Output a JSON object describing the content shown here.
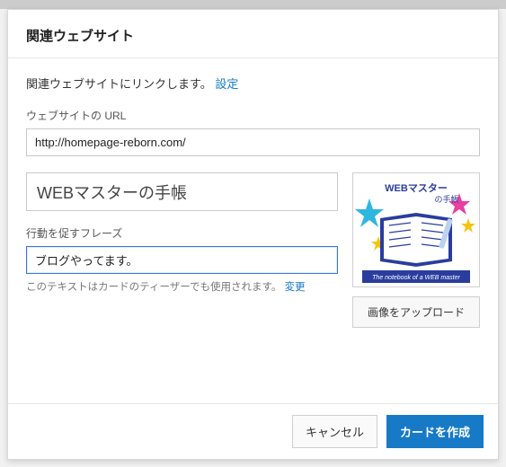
{
  "dialog": {
    "title": "関連ウェブサイト",
    "intro": "関連ウェブサイトにリンクします。",
    "settings_link": "設定"
  },
  "url_field": {
    "label": "ウェブサイトの URL",
    "value": "http://homepage-reborn.com/"
  },
  "title_field": {
    "value": "WEBマスターの手帳"
  },
  "cta_field": {
    "label": "行動を促すフレーズ",
    "value": "ブログやってます。"
  },
  "helper": {
    "text": "このテキストはカードのティーザーでも使用されます。",
    "change_link": "変更"
  },
  "thumbnail": {
    "line1": "WEBマスター",
    "line2_suffix": "の手帳",
    "caption": "The notebook of a WEB master"
  },
  "buttons": {
    "upload": "画像をアップロード",
    "cancel": "キャンセル",
    "create": "カードを作成"
  }
}
